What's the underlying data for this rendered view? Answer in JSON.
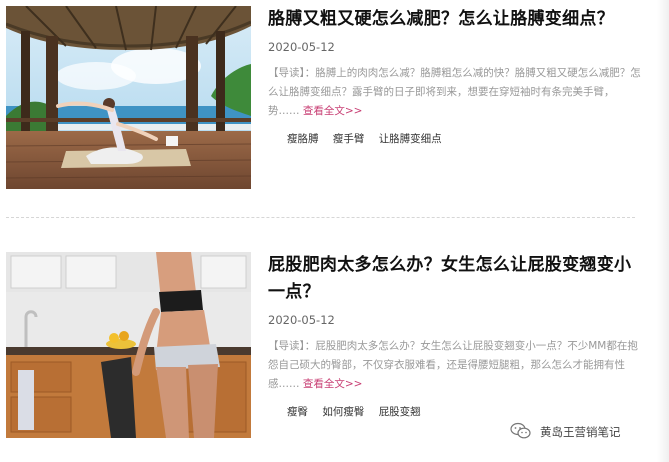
{
  "articles": [
    {
      "title": "胳膊又粗又硬怎么减肥？怎么让胳膊变细点？",
      "date": "2020-05-12",
      "summary_lead": "【导读】：",
      "summary_text": "胳膊上的肉肉怎么减？胳膊粗怎么减的快？胳膊又粗又硬怎么减肥？怎么让胳膊变细点？露手臂的日子即将到来，想要在穿短袖时有条完美手臂，势……",
      "more_label": "查看全文>>",
      "tags": [
        "瘦胳膊",
        "瘦手臂",
        "让胳膊变细点"
      ],
      "image_description": "yoga-pose-in-beach-pavilion"
    },
    {
      "title": "屁股肥肉太多怎么办？女生怎么让屁股变翘变小一点？",
      "date": "2020-05-12",
      "summary_lead": "【导读】：",
      "summary_text": "屁股肥肉太多怎么办？女生怎么让屁股变翘变小一点？不少MM都在抱怨自己硕大的臀部，不仅穿衣服难看，还是得腰短腿粗，那么怎么才能拥有性感……",
      "more_label": "查看全文>>",
      "tags": [
        "瘦臀",
        "如何瘦臀",
        "屁股变翘"
      ],
      "image_description": "woman-in-kitchen"
    }
  ],
  "watermark": {
    "icon": "wechat-icon",
    "text": "黄岛王营销笔记"
  },
  "colors": {
    "link": "#c83f74",
    "title": "#111111",
    "summary": "#999999"
  }
}
